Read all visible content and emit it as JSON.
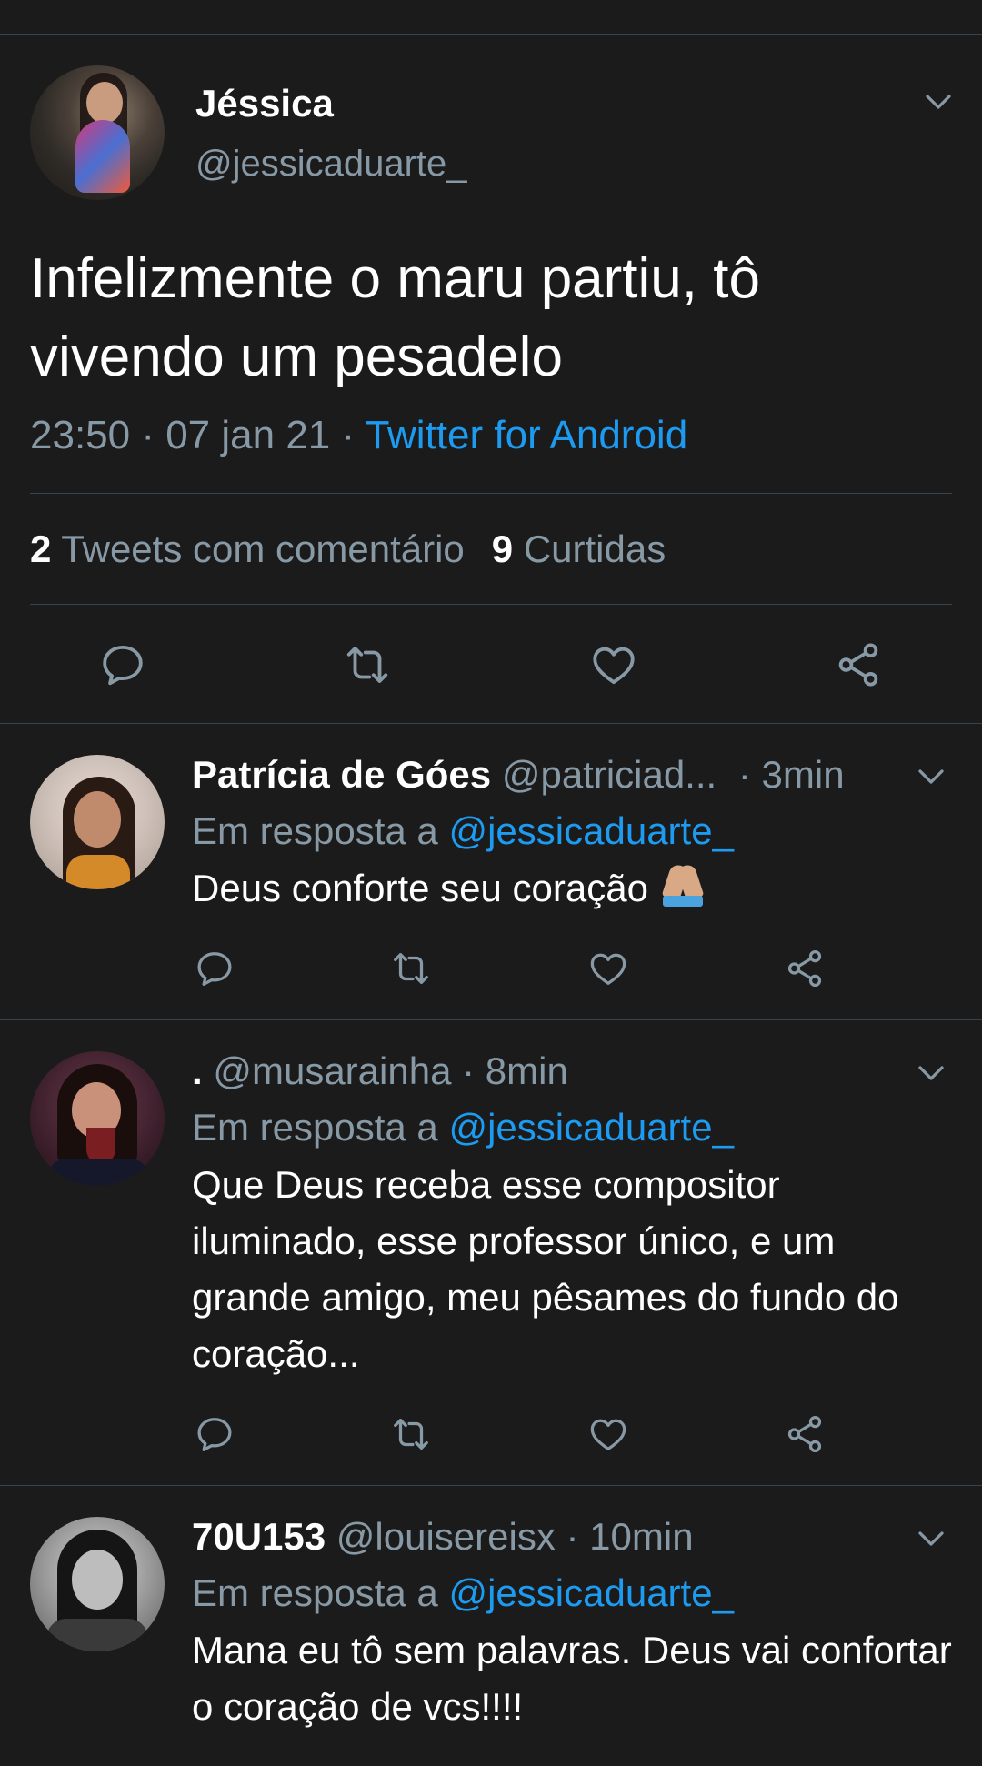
{
  "main_tweet": {
    "name": "Jéssica",
    "handle": "@jessicaduarte_",
    "text": "Infelizmente o maru partiu, tô vivendo um pesadelo",
    "time": "23:50 · 07 jan 21 · ",
    "source": "Twitter for Android",
    "quote_count": "2",
    "quote_label": "Tweets com comentário",
    "like_count": "9",
    "like_label": "Curtidas"
  },
  "replies": [
    {
      "name": "Patrícia de Góes",
      "handle": "@patriciad...",
      "time": " · 3min",
      "in_reply_prefix": "Em resposta a ",
      "in_reply_mention": "@jessicaduarte_",
      "text": "Deus conforte seu coração "
    },
    {
      "name": ".",
      "handle": "@musarainha",
      "time": " · 8min",
      "in_reply_prefix": "Em resposta a ",
      "in_reply_mention": "@jessicaduarte_",
      "text": "Que Deus receba esse compositor iluminado, esse professor único, e um grande amigo, meu pêsames do fundo do coração..."
    },
    {
      "name": "70U153",
      "handle": "@louisereisx",
      "time": " · 10min",
      "in_reply_prefix": "Em resposta a ",
      "in_reply_mention": "@jessicaduarte_",
      "text": "Mana eu tô sem palavras. Deus vai confortar o coração de vcs!!!!"
    }
  ],
  "colors": {
    "background": "#1b1b1c",
    "secondary_text": "#8899a6",
    "accent": "#1d9bf0",
    "divider": "#38444d"
  },
  "icons": [
    "chevron-down-icon",
    "reply-icon",
    "retweet-icon",
    "like-icon",
    "share-icon",
    "folded-hands-emoji"
  ]
}
